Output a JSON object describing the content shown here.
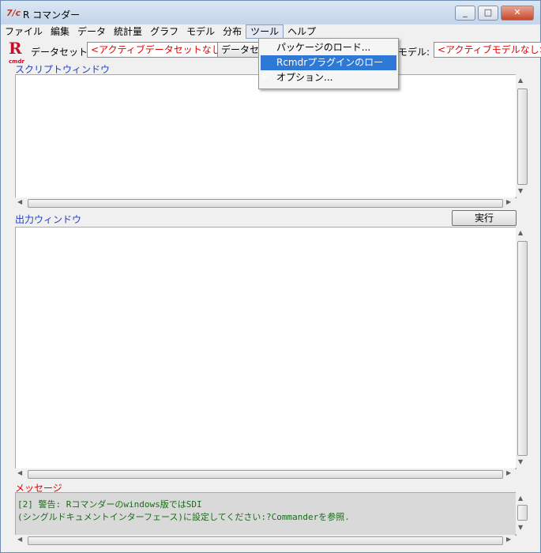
{
  "window": {
    "title": "R コマンダー",
    "icon": "Rcmdr-icon"
  },
  "menubar": {
    "items": [
      "ファイル",
      "編集",
      "データ",
      "統計量",
      "グラフ",
      "モデル",
      "分布",
      "ツール",
      "ヘルプ"
    ],
    "open_index": 7
  },
  "tools_menu": {
    "items": [
      "パッケージのロード...",
      "Rcmdrプラグインのロード...",
      "オプション..."
    ],
    "highlighted_index": 1
  },
  "toolbar": {
    "dataset_label": "データセット:",
    "dataset_value": "<アクティブデータセットなし>",
    "edit_button": "データセ",
    "model_label": "モデル:",
    "model_value": "<アクティブモデルなし>"
  },
  "script_window": {
    "label": "スクリプトウィンドウ"
  },
  "output_window": {
    "label": "出力ウィンドウ",
    "run_button": "実行"
  },
  "messages": {
    "label": "メッセージ",
    "lines": [
      "[2] 警告: Rコマンダーのwindows版ではSDI",
      "(シングルドキュメントインターフェース)に設定してください:?Commanderを参照."
    ]
  },
  "colors": {
    "accent_red": "#e00000",
    "label_blue": "#1f3fbf",
    "menu_highlight": "#2f79d6",
    "message_green": "#1a6b1a"
  }
}
